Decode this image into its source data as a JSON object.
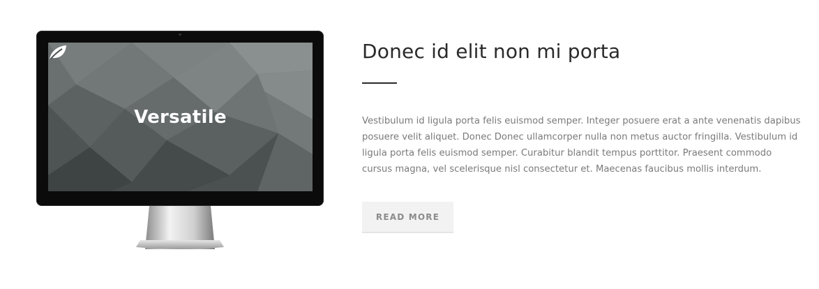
{
  "monitor": {
    "screen_brand": "Versatile",
    "brand_icon": "leaf-icon"
  },
  "article": {
    "title": "Donec id elit non mi porta",
    "body": "Vestibulum id ligula porta felis euismod semper. Integer posuere erat a ante venenatis dapibus posuere velit aliquet. Donec Donec ullamcorper nulla non metus auctor fringilla. Vestibulum id ligula porta felis euismod semper. Curabitur blandit tempus porttitor. Praesent commodo cursus magna, vel scelerisque nisl consectetur et. Maecenas faucibus mollis interdum.",
    "button_label": "READ MORE"
  },
  "colors": {
    "heading": "#2a2a2a",
    "body_text": "#7a7a7a",
    "button_bg": "#f2f2f2",
    "button_text": "#8b8b8b",
    "monitor_bezel": "#0b0b0b"
  }
}
